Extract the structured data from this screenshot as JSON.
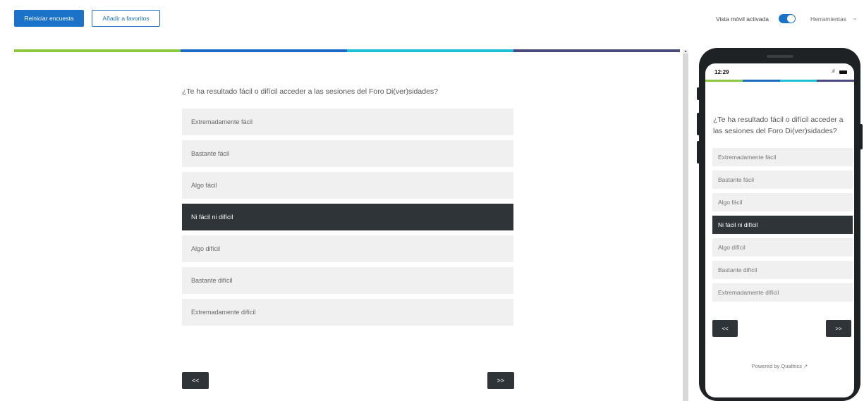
{
  "toolbar": {
    "restart_label": "Reiniciar encuesta",
    "favorites_label": "Añadir a favoritos",
    "mobile_view_label": "Vista móvil activada",
    "tools_label": "Herramientas",
    "mobile_view_enabled": true
  },
  "colors": {
    "accent": "#1a73c8",
    "selected_option": "#2e3438",
    "progress_segments": [
      "#8dc63f",
      "#1b6cc4",
      "#1fc0d4",
      "#4b4a7e"
    ]
  },
  "survey": {
    "question": "¿Te ha resultado fácil o difícil acceder a las sesiones del Foro Di(ver)sidades?",
    "options": [
      "Extremadamente fácil",
      "Bastante fácil",
      "Algo fácil",
      "Ni fácil ni difícil",
      "Algo difícil",
      "Bastante difícil",
      "Extremadamente difícil"
    ],
    "selected_option": "Ni fácil ni difícil",
    "prev_label": "<<",
    "next_label": ">>"
  },
  "phone": {
    "time": "12:29",
    "powered_by": "Powered by Qualtrics ↗"
  }
}
